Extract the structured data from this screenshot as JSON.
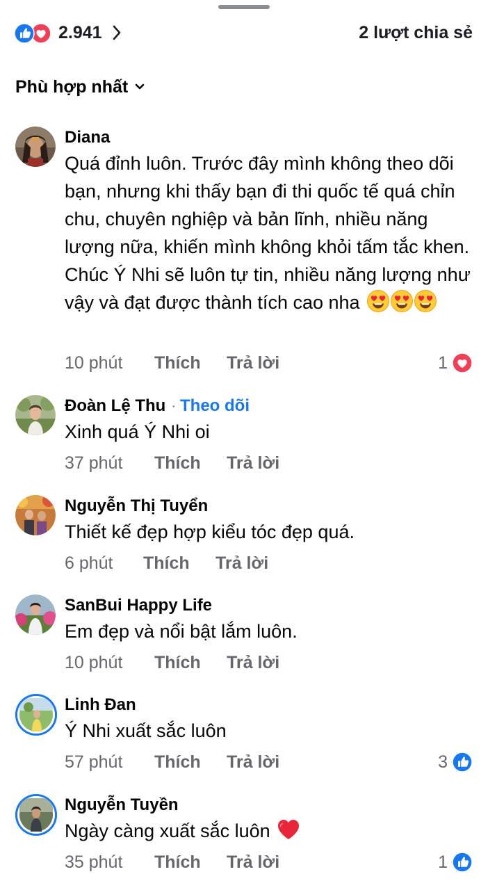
{
  "header": {
    "reaction_count": "2.941",
    "share_label": "2 lượt chia sẻ"
  },
  "sort": {
    "label": "Phù hợp nhất"
  },
  "comments": [
    {
      "author": "Diana",
      "text": "Quá đỉnh luôn. Trước đây mình không theo dõi bạn, nhưng khi thấy bạn đi thi quốc tế quá chỉn chu, chuyên nghiệp và bản lĩnh, nhiều năng lượng nữa, khiến mình không khỏi tấm tắc khen. Chúc Ý Nhi sẽ luôn tự tin, nhiều năng lượng như vậy và đạt được thành tích cao nha",
      "emoji": "heart-eyes-emoji ×3",
      "time": "10 phút",
      "like_label": "Thích",
      "reply_label": "Trả lời",
      "reaction_count": "1",
      "reaction_icon": "love-icon"
    },
    {
      "author": "Đoàn Lệ Thu",
      "separator": "·",
      "follow_label": "Theo dõi",
      "text": "Xinh quá Ý Nhi oi",
      "time": "37 phút",
      "like_label": "Thích",
      "reply_label": "Trả lời"
    },
    {
      "author": "Nguyễn Thị Tuyển",
      "text": "Thiết kế đẹp hợp kiểu tóc đẹp quá.",
      "time": "6 phút",
      "like_label": "Thích",
      "reply_label": "Trả lời"
    },
    {
      "author": "SanBui Happy Life",
      "text": "Em đẹp và nổi bật lắm luôn.",
      "time": "10 phút",
      "like_label": "Thích",
      "reply_label": "Trả lời"
    },
    {
      "author": "Linh Đan",
      "text": "Ý Nhi xuất sắc luôn",
      "time": "57 phút",
      "like_label": "Thích",
      "reply_label": "Trả lời",
      "reaction_count": "3",
      "reaction_icon": "like-icon"
    },
    {
      "author": "Nguyễn Tuyền",
      "text": "Ngày càng xuất sắc luôn",
      "emoji": "red-heart-emoji",
      "time": "35 phút",
      "like_label": "Thích",
      "reply_label": "Trả lời",
      "reaction_count": "1",
      "reaction_icon": "like-icon"
    }
  ],
  "colors": {
    "link_blue": "#1877f2",
    "meta_gray": "#65676b",
    "love_red": "#f33e58",
    "text": "#050505"
  }
}
